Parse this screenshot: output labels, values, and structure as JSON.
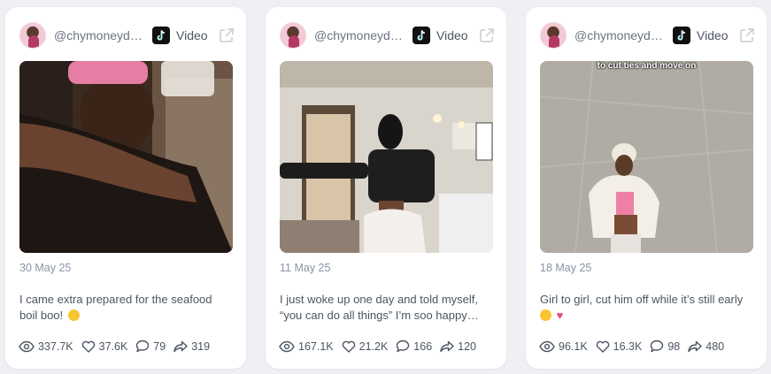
{
  "cards": [
    {
      "handle": "@chymoneydu...",
      "platform_icon": "tiktok-icon",
      "media_type": "Video",
      "date": "30 May 25",
      "description_line1": "I came extra prepared for the seafood",
      "description_line2": "boil boo!",
      "description_emoji": "grinning-emoji",
      "views": "337.7K",
      "likes": "37.6K",
      "comments": "79",
      "shares": "319",
      "overlay_text": ""
    },
    {
      "handle": "@chymoneydu...",
      "platform_icon": "tiktok-icon",
      "media_type": "Video",
      "date": "11 May 25",
      "description_line1": "I just woke up one day and told myself,",
      "description_line2": "“you can do all things” I’m soo happy…",
      "description_emoji": "",
      "views": "167.1K",
      "likes": "21.2K",
      "comments": "166",
      "shares": "120",
      "overlay_text": ""
    },
    {
      "handle": "@chymoneydu...",
      "platform_icon": "tiktok-icon",
      "media_type": "Video",
      "date": "18 May 25",
      "description_line1": "Girl to girl, cut him off while it’s still early",
      "description_line2": "",
      "description_emoji": "grinning-emoji heart-emoji",
      "views": "96.1K",
      "likes": "16.3K",
      "comments": "98",
      "shares": "480",
      "overlay_text": "to cut ties and move on"
    }
  ],
  "colors": {
    "background": "#eef0f4",
    "card": "#ffffff",
    "muted_text": "#8a94a6",
    "body_text": "#4b5563"
  }
}
